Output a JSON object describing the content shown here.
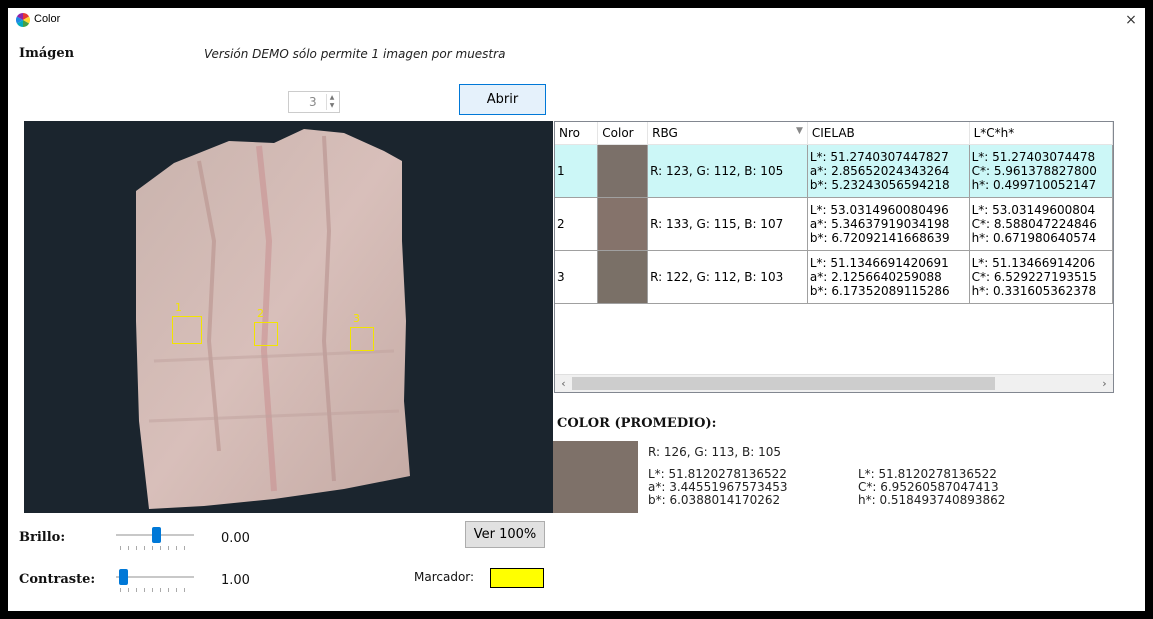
{
  "window": {
    "title": "Color",
    "close_label": "×"
  },
  "header": {
    "image_label": "Imágen",
    "demo_notice": "Versión DEMO sólo permite 1 imagen por muestra",
    "spinner_value": "3",
    "open_button": "Abrir"
  },
  "markers": [
    {
      "label": "1"
    },
    {
      "label": "2"
    },
    {
      "label": "3"
    }
  ],
  "controls": {
    "brightness_label": "Brillo:",
    "brightness_value": "0.00",
    "contrast_label": "Contraste:",
    "contrast_value": "1.00",
    "view100_button": "Ver 100%",
    "marker_label": "Marcador:",
    "marker_color": "#ffff00"
  },
  "table": {
    "columns": [
      "Nro",
      "Color",
      "RBG",
      "CIELAB",
      "L*C*h*"
    ],
    "rows": [
      {
        "nro": "1",
        "color": "#7b7069",
        "rgb": "R: 123, G: 112, B: 105",
        "lab": [
          "L*: 51.2740307447827",
          "a*: 2.85652024343264",
          "b*: 5.23243056594218"
        ],
        "lch": [
          "L*: 51.27403074478",
          "C*: 5.961378827800",
          "h*: 0.499710052147"
        ]
      },
      {
        "nro": "2",
        "color": "#85736b",
        "rgb": "R: 133, G: 115, B: 107",
        "lab": [
          "L*: 53.0314960080496",
          "a*: 5.34637919034198",
          "b*: 6.72092141668639"
        ],
        "lch": [
          "L*: 53.03149600804",
          "C*: 8.588047224846",
          "h*: 0.671980640574"
        ]
      },
      {
        "nro": "3",
        "color": "#7a7067",
        "rgb": "R: 122, G: 112, B: 103",
        "lab": [
          "L*: 51.1346691420691",
          "a*: 2.1256640259088",
          "b*: 6.17352089115286"
        ],
        "lch": [
          "L*: 51.13466914206",
          "C*: 6.529227193515",
          "h*: 0.331605362378"
        ]
      }
    ]
  },
  "average": {
    "title": "COLOR (PROMEDIO):",
    "color": "#7e7169",
    "rgb": "R: 126, G: 113, B: 105",
    "lab": [
      "L*: 51.8120278136522",
      "a*: 3.44551967573453",
      "b*: 6.0388014170262"
    ],
    "lch": [
      "L*: 51.8120278136522",
      "C*: 6.95260587047413",
      "h*: 0.518493740893862"
    ]
  }
}
